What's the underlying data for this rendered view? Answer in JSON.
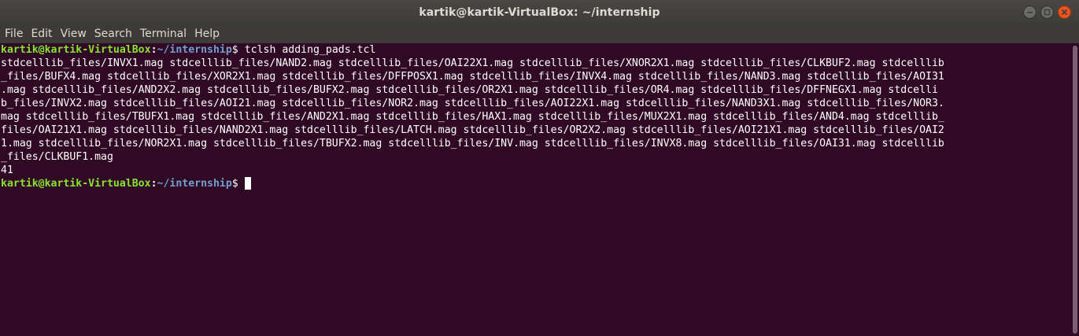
{
  "window": {
    "title": "kartik@kartik-VirtualBox: ~/internship"
  },
  "menu": {
    "items": [
      "File",
      "Edit",
      "View",
      "Search",
      "Terminal",
      "Help"
    ]
  },
  "terminal": {
    "prompt": {
      "user_host": "kartik@kartik-VirtualBox",
      "colon": ":",
      "path": "~/internship",
      "dollar": "$ "
    },
    "command": "tclsh adding_pads.tcl",
    "output_lines": [
      "stdcelllib_files/INVX1.mag stdcelllib_files/NAND2.mag stdcelllib_files/OAI22X1.mag stdcelllib_files/XNOR2X1.mag stdcelllib_files/CLKBUF2.mag stdcelllib",
      "_files/BUFX4.mag stdcelllib_files/XOR2X1.mag stdcelllib_files/DFFPOSX1.mag stdcelllib_files/INVX4.mag stdcelllib_files/NAND3.mag stdcelllib_files/AOI31",
      ".mag stdcelllib_files/AND2X2.mag stdcelllib_files/BUFX2.mag stdcelllib_files/OR2X1.mag stdcelllib_files/OR4.mag stdcelllib_files/DFFNEGX1.mag stdcelli",
      "b_files/INVX2.mag stdcelllib_files/AOI21.mag stdcelllib_files/NOR2.mag stdcelllib_files/AOI22X1.mag stdcelllib_files/NAND3X1.mag stdcelllib_files/NOR3.",
      "mag stdcelllib_files/TBUFX1.mag stdcelllib_files/AND2X1.mag stdcelllib_files/HAX1.mag stdcelllib_files/MUX2X1.mag stdcelllib_files/AND4.mag stdcelllib_",
      "files/OAI21X1.mag stdcelllib_files/NAND2X1.mag stdcelllib_files/LATCH.mag stdcelllib_files/OR2X2.mag stdcelllib_files/AOI21X1.mag stdcelllib_files/OAI2",
      "1.mag stdcelllib_files/NOR2X1.mag stdcelllib_files/TBUFX2.mag stdcelllib_files/INV.mag stdcelllib_files/INVX8.mag stdcelllib_files/OAI31.mag stdcelllib",
      "_files/CLKBUF1.mag",
      "41"
    ]
  },
  "icons": {
    "minimize": "minimize-icon",
    "maximize": "maximize-icon",
    "close": "close-icon"
  },
  "colors": {
    "terminal_bg": "#300a24",
    "prompt_user": "#8ae234",
    "prompt_path": "#729fcf",
    "close_button": "#e9541f"
  }
}
